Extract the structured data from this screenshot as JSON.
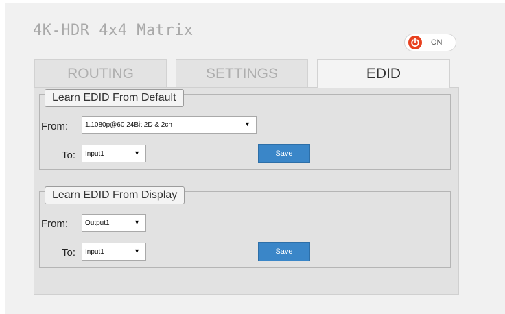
{
  "app": {
    "title": "4K-HDR 4x4 Matrix"
  },
  "power": {
    "label": "ON",
    "icon": "power-icon",
    "color": "#e8411f"
  },
  "tabs": [
    {
      "label": "ROUTING",
      "active": false
    },
    {
      "label": "SETTINGS",
      "active": false
    },
    {
      "label": "EDID",
      "active": true
    }
  ],
  "learn_default": {
    "title": "Learn EDID From Default",
    "from_label": "From:",
    "from_value": "1.1080p@60 24Bit 2D & 2ch",
    "to_label": "To:",
    "to_value": "Input1",
    "save_label": "Save"
  },
  "learn_display": {
    "title": "Learn EDID From Display",
    "from_label": "From:",
    "from_value": "Output1",
    "to_label": "To:",
    "to_value": "Input1",
    "save_label": "Save"
  },
  "colors": {
    "accent": "#3a86c8",
    "power": "#e8411f"
  }
}
